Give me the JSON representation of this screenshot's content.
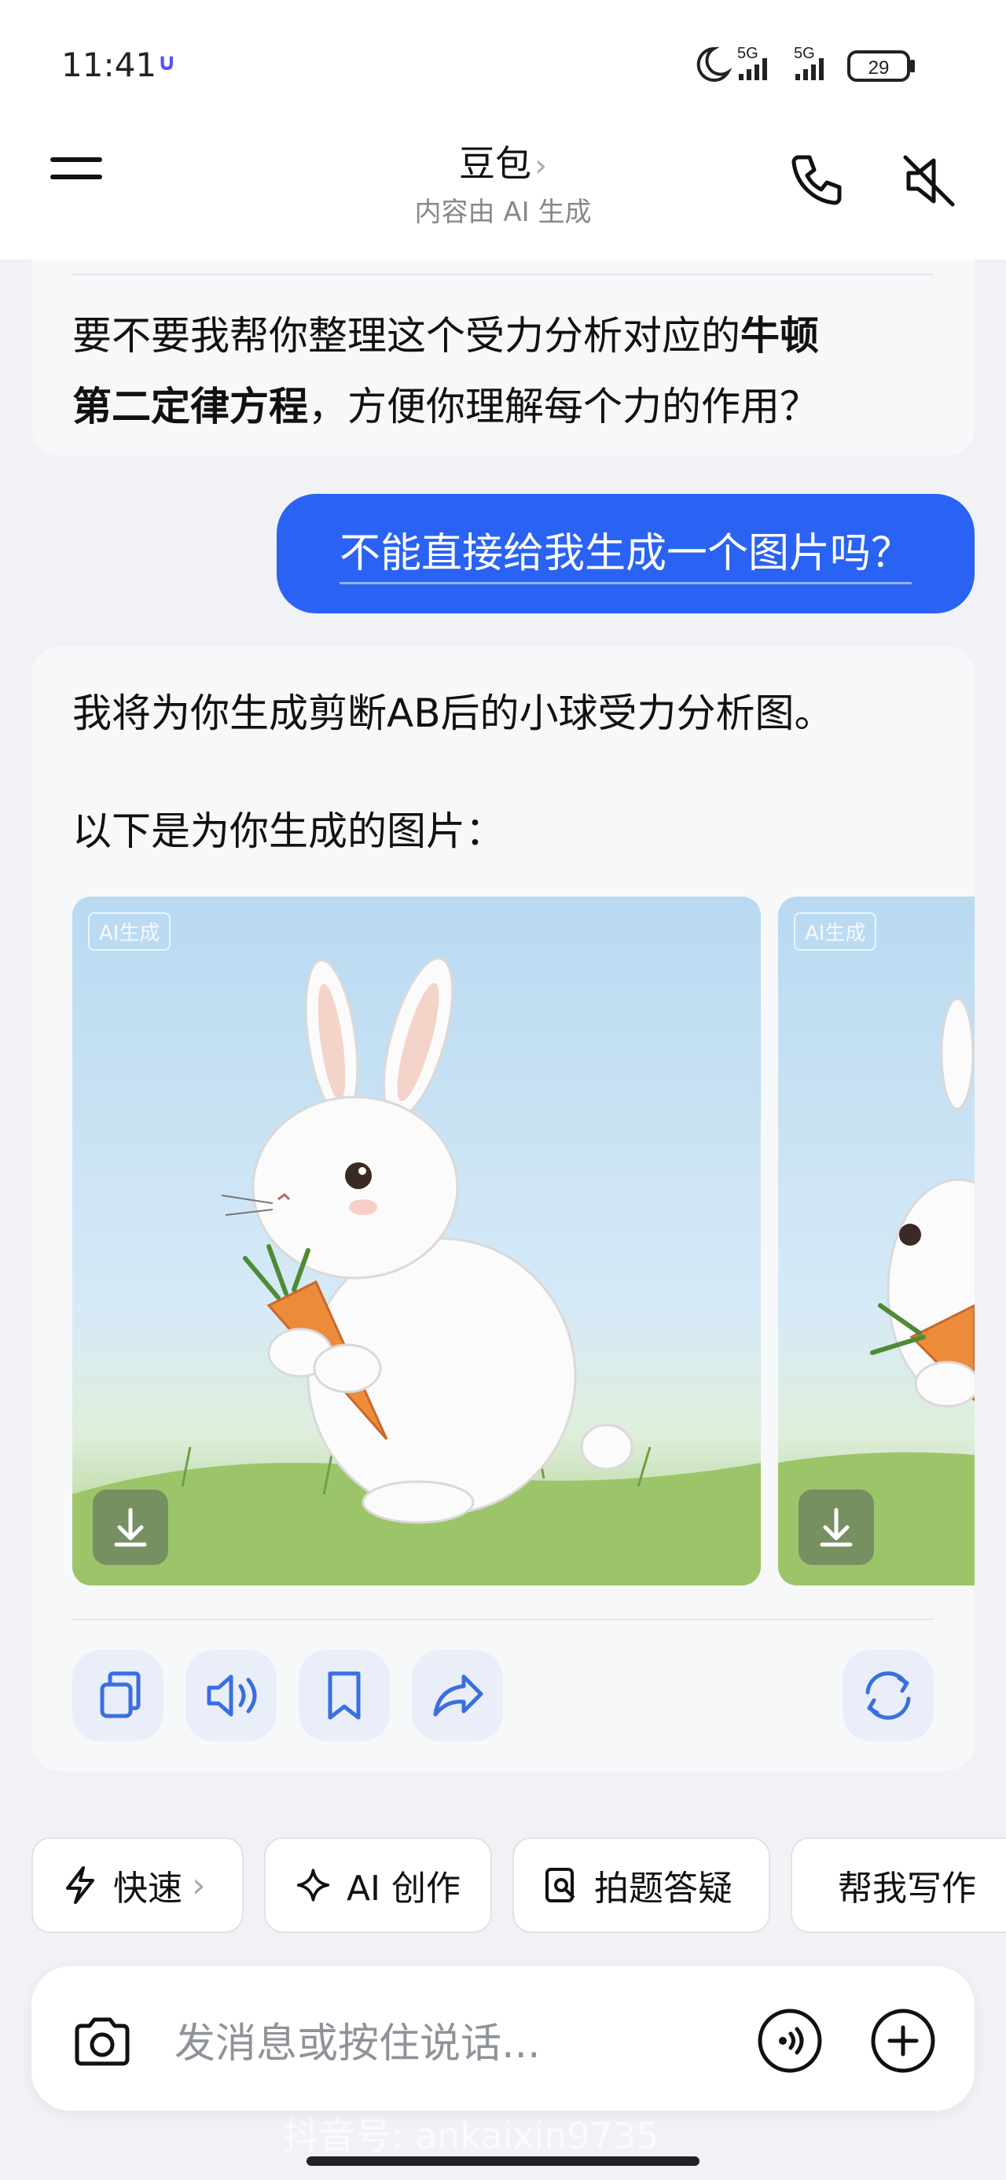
{
  "status_bar": {
    "time": "11:41",
    "indicator": "∪",
    "network_1": "5G",
    "network_2": "5G",
    "battery": "29"
  },
  "header": {
    "title": "豆包",
    "title_chevron": "›",
    "subtitle": "内容由 AI 生成",
    "icons": [
      "menu-icon",
      "phone-icon",
      "speaker-muted-icon"
    ]
  },
  "chat": {
    "ai_message_1": {
      "part1": "要不要我帮你整理这个受力分析对应的",
      "bold1": "牛顿",
      "bold2": "第二定律方程",
      "part2": "，方便你理解每个力的作用？"
    },
    "user_message": "不能直接给我生成一个图片吗？",
    "ai_message_2": {
      "line1": "我将为你生成剪断AB后的小球受力分析图。",
      "line2": "以下是为你生成的图片："
    },
    "images": [
      {
        "tag": "AI生成",
        "subject": "white-rabbit-holding-carrot"
      },
      {
        "tag": "AI生成",
        "subject": "white-rabbit-holding-carrot"
      }
    ],
    "actions": [
      "copy-icon",
      "speaker-icon",
      "bookmark-icon",
      "share-icon",
      "regenerate-icon"
    ]
  },
  "quick_chips": [
    {
      "label": "快速",
      "suffix": "›",
      "icon": "lightning-icon"
    },
    {
      "label": "AI 创作",
      "icon": "sparkle-icon"
    },
    {
      "label": "拍题答疑",
      "icon": "photo-question-icon"
    },
    {
      "label": "帮我写作",
      "icon": "edit-icon"
    }
  ],
  "input": {
    "placeholder": "发消息或按住说话..."
  },
  "watermark": "抖音号: ankaixin9735",
  "colors": {
    "accent": "#2a62f3",
    "icon_blue": "#3a6fe0"
  }
}
